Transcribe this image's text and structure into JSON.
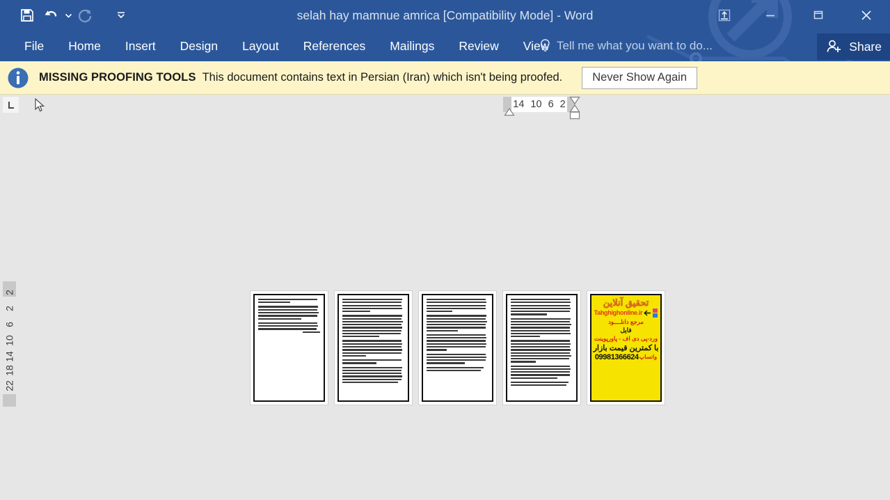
{
  "titlebar": {
    "document_title": "selah hay mamnue amrica [Compatibility Mode] - Word",
    "quick_access": [
      {
        "name": "save",
        "icon": "save-icon",
        "label": "Save"
      },
      {
        "name": "undo",
        "icon": "undo-icon",
        "label": "Undo"
      },
      {
        "name": "undo-dropdown",
        "icon": "chevron-down-icon",
        "label": "Undo options"
      },
      {
        "name": "redo",
        "icon": "redo-icon",
        "label": "Repeat"
      },
      {
        "name": "customize-qat",
        "icon": "chevron-down-bar-icon",
        "label": "Customize Quick Access Toolbar"
      }
    ],
    "window_controls": [
      {
        "name": "ribbon-display-options",
        "icon": "ribbon-display-icon",
        "label": "Ribbon Display Options"
      },
      {
        "name": "minimize",
        "icon": "minimize-icon",
        "label": "Minimize"
      },
      {
        "name": "restore",
        "icon": "restore-icon",
        "label": "Restore Down"
      },
      {
        "name": "close",
        "icon": "close-icon",
        "label": "Close"
      }
    ]
  },
  "ribbon": {
    "tabs": [
      {
        "label": "File"
      },
      {
        "label": "Home"
      },
      {
        "label": "Insert"
      },
      {
        "label": "Design"
      },
      {
        "label": "Layout"
      },
      {
        "label": "References"
      },
      {
        "label": "Mailings"
      },
      {
        "label": "Review"
      },
      {
        "label": "View"
      }
    ],
    "tell_me": {
      "icon": "lightbulb-icon",
      "placeholder": "Tell me what you want to do..."
    },
    "share": {
      "icon": "share-person-icon",
      "label": "Share"
    }
  },
  "message_bar": {
    "icon": "info-icon",
    "title": "MISSING PROOFING TOOLS",
    "text": "This document contains text in Persian (Iran) which isn't being proofed.",
    "button_label": "Never Show Again",
    "background": "#FDF5C8"
  },
  "rulers": {
    "tab_stop_selector": "L",
    "horizontal_ticks": [
      "14",
      "10",
      "6",
      "2"
    ],
    "vertical_ticks": [
      "2",
      "2",
      "6",
      "10",
      "14",
      "18",
      "22"
    ]
  },
  "colors": {
    "word_blue": "#2B579A",
    "share_blue": "#1E4484",
    "canvas_gray": "#E6E6E6",
    "message_yellow": "#FDF5C8",
    "ad_yellow": "#F6E400"
  },
  "document": {
    "view": "multiple-pages",
    "page_count": 5,
    "pages": [
      {
        "index": 1,
        "type": "text",
        "paragraphs": [
          2,
          5,
          4
        ]
      },
      {
        "index": 2,
        "type": "text",
        "paragraphs": [
          5,
          8,
          6,
          5,
          2,
          6
        ]
      },
      {
        "index": 3,
        "type": "text",
        "paragraphs": [
          5,
          6,
          6,
          5,
          2
        ]
      },
      {
        "index": 4,
        "type": "text",
        "paragraphs": [
          6,
          7,
          8,
          6,
          5
        ]
      },
      {
        "index": 5,
        "type": "advertisement"
      }
    ],
    "ad_page": {
      "title_line1": "تحقیق آنلاین",
      "url": "Tahghighonline.ir",
      "line_marja": "مرجع دانلــــود",
      "line_file": "فایل",
      "line_formats": "ورد-پی دی اف - پاورپوینت",
      "line_price": "با کمترین قیمت بازار",
      "phone": "09981366624",
      "whatsapp_label": "واتساپ"
    }
  }
}
